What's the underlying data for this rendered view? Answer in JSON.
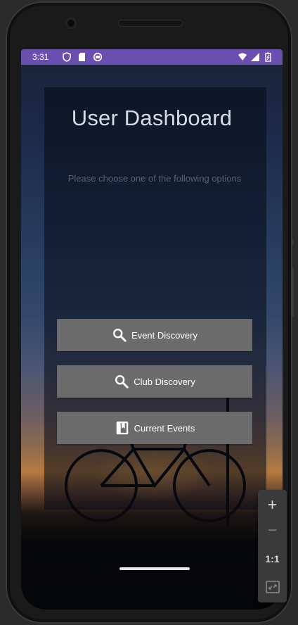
{
  "status_bar": {
    "time": "3:31",
    "left_icons": [
      "shield-icon",
      "sd-card-icon",
      "sync-icon"
    ],
    "right_icons": [
      "wifi-icon",
      "signal-icon",
      "battery-icon"
    ],
    "color": "#6a4fb0"
  },
  "main": {
    "title": "User Dashboard",
    "subtitle": "Please choose one of the following options",
    "buttons": [
      {
        "label": "Event Discovery",
        "icon": "search-icon"
      },
      {
        "label": "Club Discovery",
        "icon": "search-icon"
      },
      {
        "label": "Current Events",
        "icon": "bookmark-icon"
      }
    ],
    "button_color": "#6b6b6b"
  },
  "emulator_controls": {
    "zoom_in": "+",
    "zoom_out": "−",
    "actual_size": "1:1"
  }
}
